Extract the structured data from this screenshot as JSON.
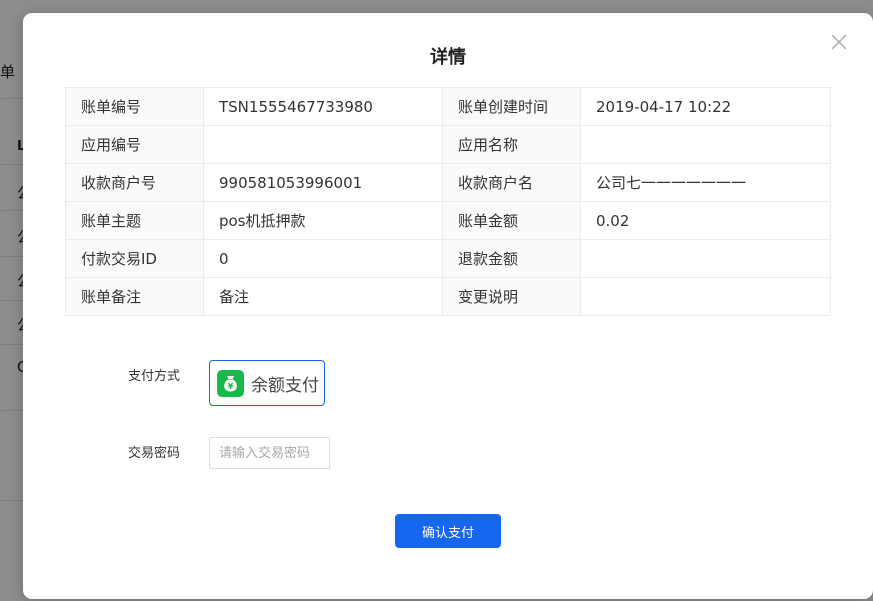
{
  "background": {
    "partial_text_1": "单",
    "partial_text_2": "L",
    "partial_text_3": "公",
    "partial_text_4": "公",
    "partial_text_5": "公",
    "partial_text_6": "公",
    "partial_text_7": "C"
  },
  "dialog": {
    "title": "详情",
    "close_icon": "close-icon",
    "details": [
      {
        "label_left": "账单编号",
        "value_left": "TSN1555467733980",
        "label_right": "账单创建时间",
        "value_right": "2019-04-17 10:22"
      },
      {
        "label_left": "应用编号",
        "value_left": "",
        "label_right": "应用名称",
        "value_right": ""
      },
      {
        "label_left": "收款商户号",
        "value_left": "990581053996001",
        "label_right": "收款商户名",
        "value_right": "公司七一一一一一一一"
      },
      {
        "label_left": "账单主题",
        "value_left": "pos机抵押款",
        "label_right": "账单金额",
        "value_right": "0.02"
      },
      {
        "label_left": "付款交易ID",
        "value_left": "0",
        "label_right": "退款金额",
        "value_right": ""
      },
      {
        "label_left": "账单备注",
        "value_left": "备注",
        "label_right": "变更说明",
        "value_right": ""
      }
    ],
    "payment": {
      "method_label": "支付方式",
      "method_option": "余额支付",
      "method_icon": "wallet-icon",
      "password_label": "交易密码",
      "password_placeholder": "请输入交易密码",
      "password_value": ""
    },
    "confirm_label": "确认支付"
  },
  "colors": {
    "primary": "#1766f0",
    "wallet_green": "#19b84a",
    "mask": "rgba(0,0,0,0.45)"
  }
}
